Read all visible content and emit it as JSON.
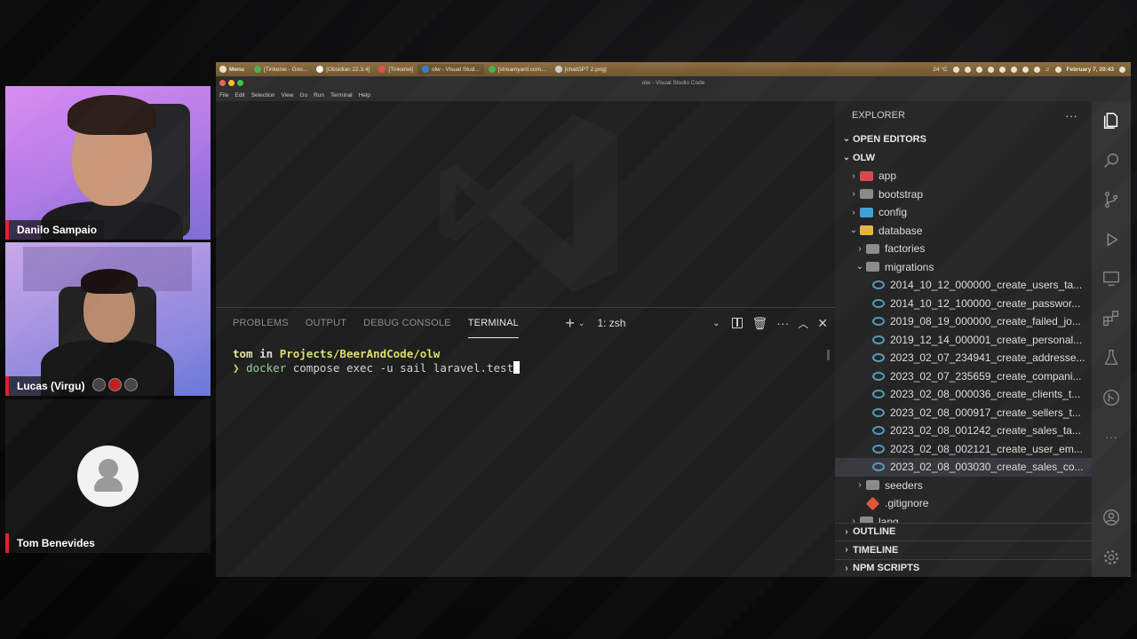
{
  "participants": [
    {
      "name": "Danilo Sampaio"
    },
    {
      "name": "Lucas (Virgu)"
    },
    {
      "name": "Tom Benevides"
    }
  ],
  "panel": {
    "menu_label": "Menu",
    "tasks": [
      "[Tinkerwi - Goo...",
      "[Obsidian 22.3.4]",
      "[Tinkerwi]",
      "olw - Visual Stud...",
      "[streamyard.com...",
      "[chatGPT 2.png]"
    ],
    "weather": "24 °C",
    "clock": "February 7, 20:43"
  },
  "window": {
    "title": "olw - Visual Studio Code",
    "menu": [
      "File",
      "Edit",
      "Selection",
      "View",
      "Go",
      "Run",
      "Terminal",
      "Help"
    ]
  },
  "terminal": {
    "tabs": [
      "PROBLEMS",
      "OUTPUT",
      "DEBUG CONSOLE",
      "TERMINAL"
    ],
    "active_tab": "TERMINAL",
    "shell_select": "1: zsh",
    "line1_user": "tom",
    "line1_in": "in",
    "line1_path": "Projects/BeerAndCode/olw",
    "prompt_symbol": "❯",
    "cmd_word": "docker",
    "cmd_rest": "compose exec -u sail laravel.test"
  },
  "explorer": {
    "header": "EXPLORER",
    "open_editors": "OPEN EDITORS",
    "project": "OLW",
    "items": [
      {
        "label": "app",
        "depth": 1,
        "type": "folder",
        "color": "#d04a4a",
        "expanded": false
      },
      {
        "label": "bootstrap",
        "depth": 1,
        "type": "folder",
        "color": "#8a8a8a",
        "expanded": false
      },
      {
        "label": "config",
        "depth": 1,
        "type": "folder",
        "color": "#3fa0d8",
        "expanded": false
      },
      {
        "label": "database",
        "depth": 1,
        "type": "folder",
        "color": "#e8b53a",
        "expanded": true
      },
      {
        "label": "factories",
        "depth": 2,
        "type": "folder",
        "color": "#8a8a8a",
        "expanded": false
      },
      {
        "label": "migrations",
        "depth": 2,
        "type": "folder",
        "color": "#8a8a8a",
        "expanded": true
      },
      {
        "label": "2014_10_12_000000_create_users_ta...",
        "depth": 3,
        "type": "file"
      },
      {
        "label": "2014_10_12_100000_create_passwor...",
        "depth": 3,
        "type": "file"
      },
      {
        "label": "2019_08_19_000000_create_failed_jo...",
        "depth": 3,
        "type": "file"
      },
      {
        "label": "2019_12_14_000001_create_personal...",
        "depth": 3,
        "type": "file"
      },
      {
        "label": "2023_02_07_234941_create_addresse...",
        "depth": 3,
        "type": "file"
      },
      {
        "label": "2023_02_07_235659_create_compani...",
        "depth": 3,
        "type": "file"
      },
      {
        "label": "2023_02_08_000036_create_clients_t...",
        "depth": 3,
        "type": "file"
      },
      {
        "label": "2023_02_08_000917_create_sellers_t...",
        "depth": 3,
        "type": "file"
      },
      {
        "label": "2023_02_08_001242_create_sales_ta...",
        "depth": 3,
        "type": "file"
      },
      {
        "label": "2023_02_08_002121_create_user_em...",
        "depth": 3,
        "type": "file"
      },
      {
        "label": "2023_02_08_003030_create_sales_co...",
        "depth": 3,
        "type": "file",
        "selected": true
      },
      {
        "label": "seeders",
        "depth": 2,
        "type": "folder",
        "color": "#8a8a8a",
        "expanded": false
      },
      {
        "label": ".gitignore",
        "depth": 2,
        "type": "git"
      },
      {
        "label": "lang",
        "depth": 1,
        "type": "folder",
        "color": "#8a8a8a",
        "expanded": false
      }
    ],
    "bottom_sections": [
      "OUTLINE",
      "TIMELINE",
      "NPM SCRIPTS"
    ]
  },
  "activity_icons": [
    "explorer-icon",
    "search-icon",
    "source-control-icon",
    "run-debug-icon",
    "remote-explorer-icon",
    "extensions-icon",
    "testing-icon",
    "git-graph-icon",
    "more-icon"
  ],
  "activity_bottom_icons": [
    "account-icon",
    "manage-gear-icon"
  ]
}
